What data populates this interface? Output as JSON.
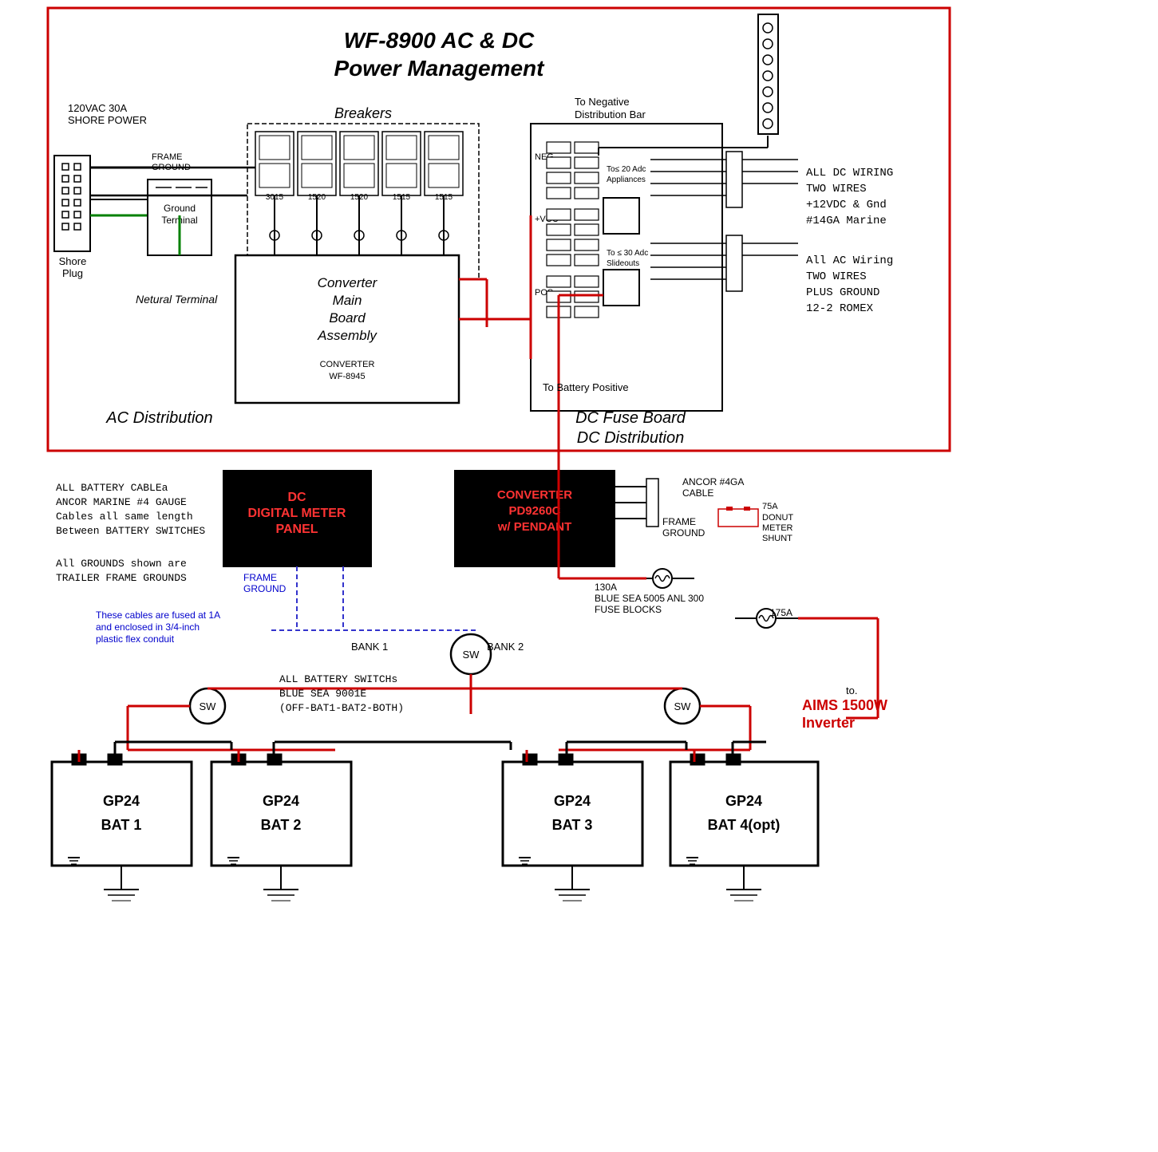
{
  "title": "WF-8900 AC & DC Power Management",
  "diagram": {
    "title_line1": "WF-8900 AC & DC",
    "title_line2": "Power Management",
    "ac_section_label": "AC Distribution",
    "dc_section_label": "DC Distribution",
    "breakers_label": "Breakers",
    "shore_power_label": "120VAC 30A\nSHORE POWER",
    "shore_plug_label": "Shore\nPlug",
    "frame_ground_label": "FRAME\nGROUND",
    "ground_terminal_label": "Ground\nTerminal",
    "neutral_terminal_label": "Netural\nTerminal",
    "converter_label": "Converter\nMain\nBoard\nAssembly",
    "converter_id": "CONVERTER\nWF-8945",
    "neg_label": "NEG-",
    "vcc_label": "+VCC",
    "pos_label": "POS",
    "to_negative_dist": "To Negative\nDistribution Bar",
    "to_20adc": "To≤ 20 Adc\nAppliances",
    "to_30adc": "To ≤ 30 Adc\nSlideouts",
    "to_battery_positive": "To Battery Positive",
    "dc_fuse_board": "DC Fuse Board",
    "breaker_labels": [
      "3015",
      "1520",
      "1520",
      "1515",
      "1515"
    ],
    "right_side_notes": {
      "line1": "ALL DC WIRING",
      "line2": "TWO WIRES",
      "line3": "+12VDC & Gnd",
      "line4": "#14GA Marine",
      "line6": "All AC Wiring",
      "line7": "TWO WIRES",
      "line8": "PLUS GROUND",
      "line9": "12-2 ROMEX"
    },
    "bottom_section": {
      "battery_cables_note": "ALL BATTERY CABLEa\nANCOR MARINE #4 GAUGE\nCables all same length\nBetween BATTERY SWITCHES",
      "grounds_note": "All GROUNDS shown are\nTRAILER FRAME GROUNDS",
      "frame_ground_blue": "FRAME\nGROUND",
      "fused_note": "These cables are fused at 1A\nand enclosed in 3/4-inch\nplastic flex conduit",
      "bank1_label": "BANK 1",
      "bank2_label": "BANK 2",
      "sw_label": "SW",
      "battery_switches_note": "ALL BATTERY SWITCHs\nBLUE SEA 9001E\n(OFF-BAT1-BAT2-BOTH)",
      "ancor_cable": "ANCOR #4GA\nCABLE",
      "shunt_label": "75A\nDONUT\nMETER\nSHUNT",
      "fuse_130": "130A\nBLUE SEA 5005 ANL 300\nFUSE BLOCKS",
      "fuse_175": "175A",
      "dc_meter_panel": "DC\nDIGITAL METER\nPANEL",
      "converter_pd": "CONVERTER\nPD9260C\nw/ PENDANT",
      "aims_label": "to.\nAIMS 1500W\nInverter",
      "bat1_label": "GP24\nBAT 1",
      "bat2_label": "GP24\nBAT 2",
      "bat3_label": "GP24\nBAT 3",
      "bat4_label": "GP24\nBAT 4(opt)"
    }
  }
}
